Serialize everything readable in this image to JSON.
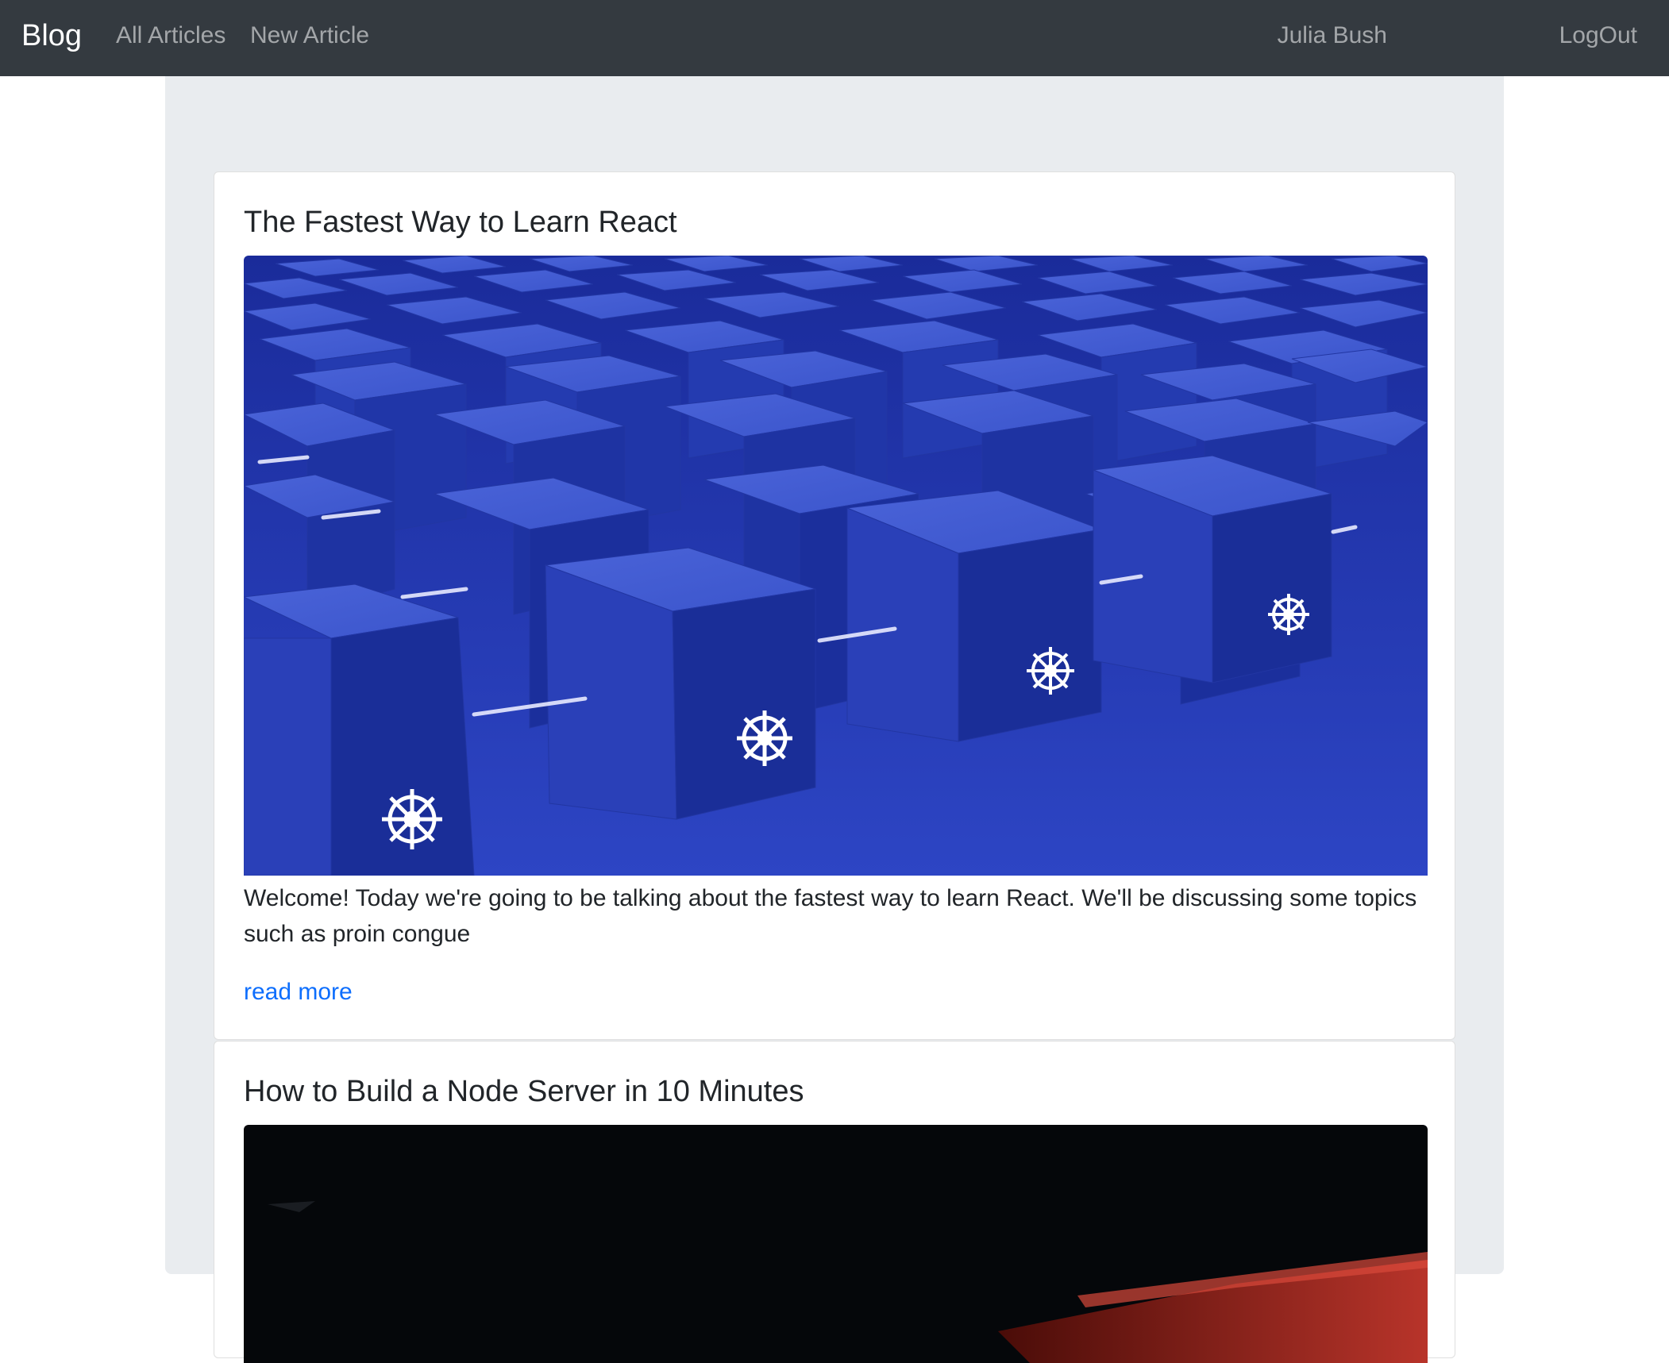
{
  "navbar": {
    "brand": "Blog",
    "links": {
      "all_articles": "All Articles",
      "new_article": "New Article",
      "user": "Julia Bush",
      "logout": "LogOut"
    }
  },
  "articles": [
    {
      "title": "The Fastest Way to Learn React",
      "image": "blue-cubes-kubernetes-image",
      "excerpt": "Welcome! Today we're going to be talking about the fastest way to learn React. We'll be discussing some topics such as proin congue",
      "read_more": "read more"
    },
    {
      "title": "How to Build a Node Server in 10 Minutes",
      "image": "dark-red-hardware-image"
    }
  ],
  "colors": {
    "navbar_bg": "#343a40",
    "jumbotron_bg": "#e9ecef",
    "link": "#0d6efd",
    "image_blue": "#2a3fb8"
  }
}
